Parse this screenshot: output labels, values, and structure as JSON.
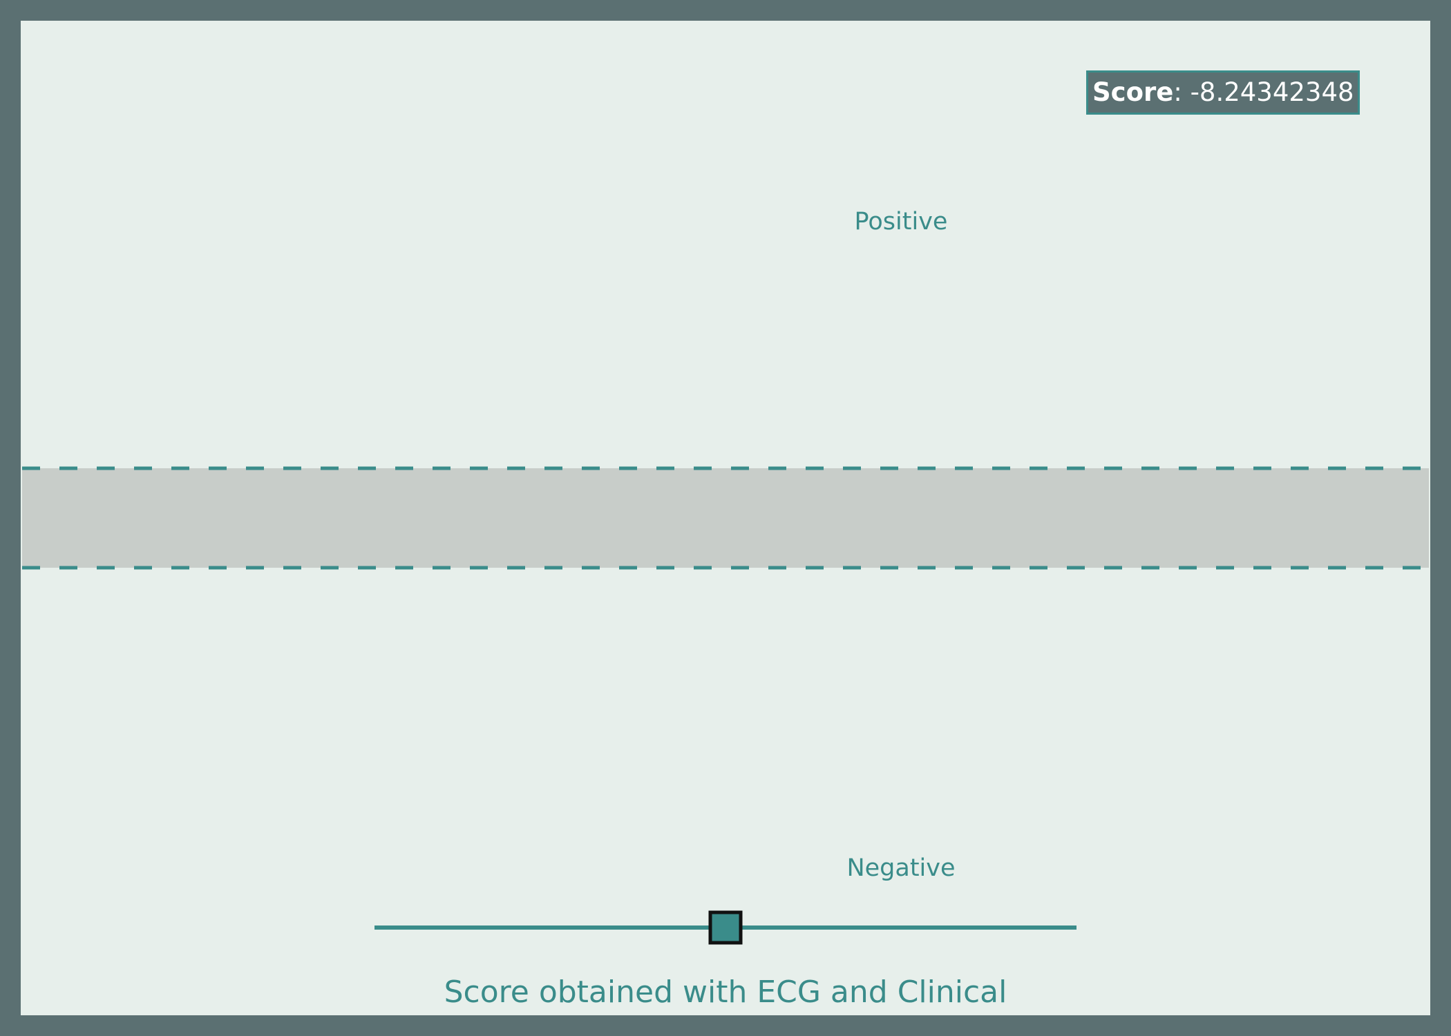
{
  "score_badge": {
    "label": "Score",
    "separator": ":",
    "value": "-8.24342348"
  },
  "chart_data": {
    "type": "line",
    "title": "",
    "xlabel": "Score obtained with ECG and Clinical",
    "ylabel": "",
    "annotations": [
      {
        "text": "Positive",
        "region": "above band"
      },
      {
        "text": "Negative",
        "region": "below band"
      }
    ],
    "grid": false,
    "legend": "none",
    "slider": {
      "value": 0.5,
      "min": 0,
      "max": 1
    },
    "colors": {
      "accent": "#3a8c8a",
      "band": "#c8cdc9",
      "background": "#e7efeb",
      "frame": "#5b7072",
      "handle_border": "#111111",
      "badge_text": "#ffffff"
    }
  }
}
